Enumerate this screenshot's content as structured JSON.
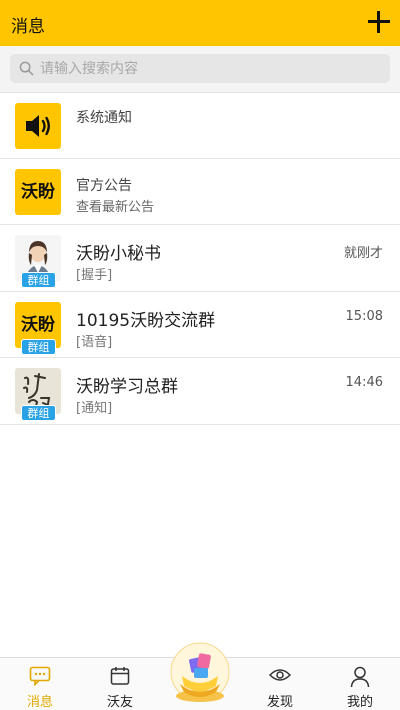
{
  "header": {
    "title": "消息",
    "add_icon": "plus-icon"
  },
  "search": {
    "placeholder": "请输入搜索内容"
  },
  "system": [
    {
      "title": "系统通知",
      "subtitle": "",
      "icon": "speaker-icon"
    },
    {
      "title": "官方公告",
      "subtitle": "查看最新公告",
      "logo": "沃盼"
    }
  ],
  "chats": [
    {
      "title": "沃盼小秘书",
      "preview": "[握手]",
      "time": "就刚才",
      "badge": "群组",
      "avatar": "assistant-avatar"
    },
    {
      "title": "10195沃盼交流群",
      "preview": "[语音]",
      "time": "15:08",
      "badge": "群组",
      "logo": "沃盼"
    },
    {
      "title": "沃盼学习总群",
      "preview": "[通知]",
      "time": "14:46",
      "badge": "群组",
      "avatar": "calligraphy-avatar"
    }
  ],
  "tabbar": {
    "items": [
      {
        "label": "消息",
        "icon": "message-icon",
        "active": true
      },
      {
        "label": "沃友",
        "icon": "calendar-icon",
        "active": false
      },
      {
        "label": "",
        "icon": "treasure-box-icon",
        "active": false
      },
      {
        "label": "发现",
        "icon": "eye-icon",
        "active": false
      },
      {
        "label": "我的",
        "icon": "user-icon",
        "active": false
      }
    ]
  },
  "colors": {
    "accent": "#ffc600",
    "badge": "#2aa3e6",
    "active_tab": "#e0a800"
  }
}
